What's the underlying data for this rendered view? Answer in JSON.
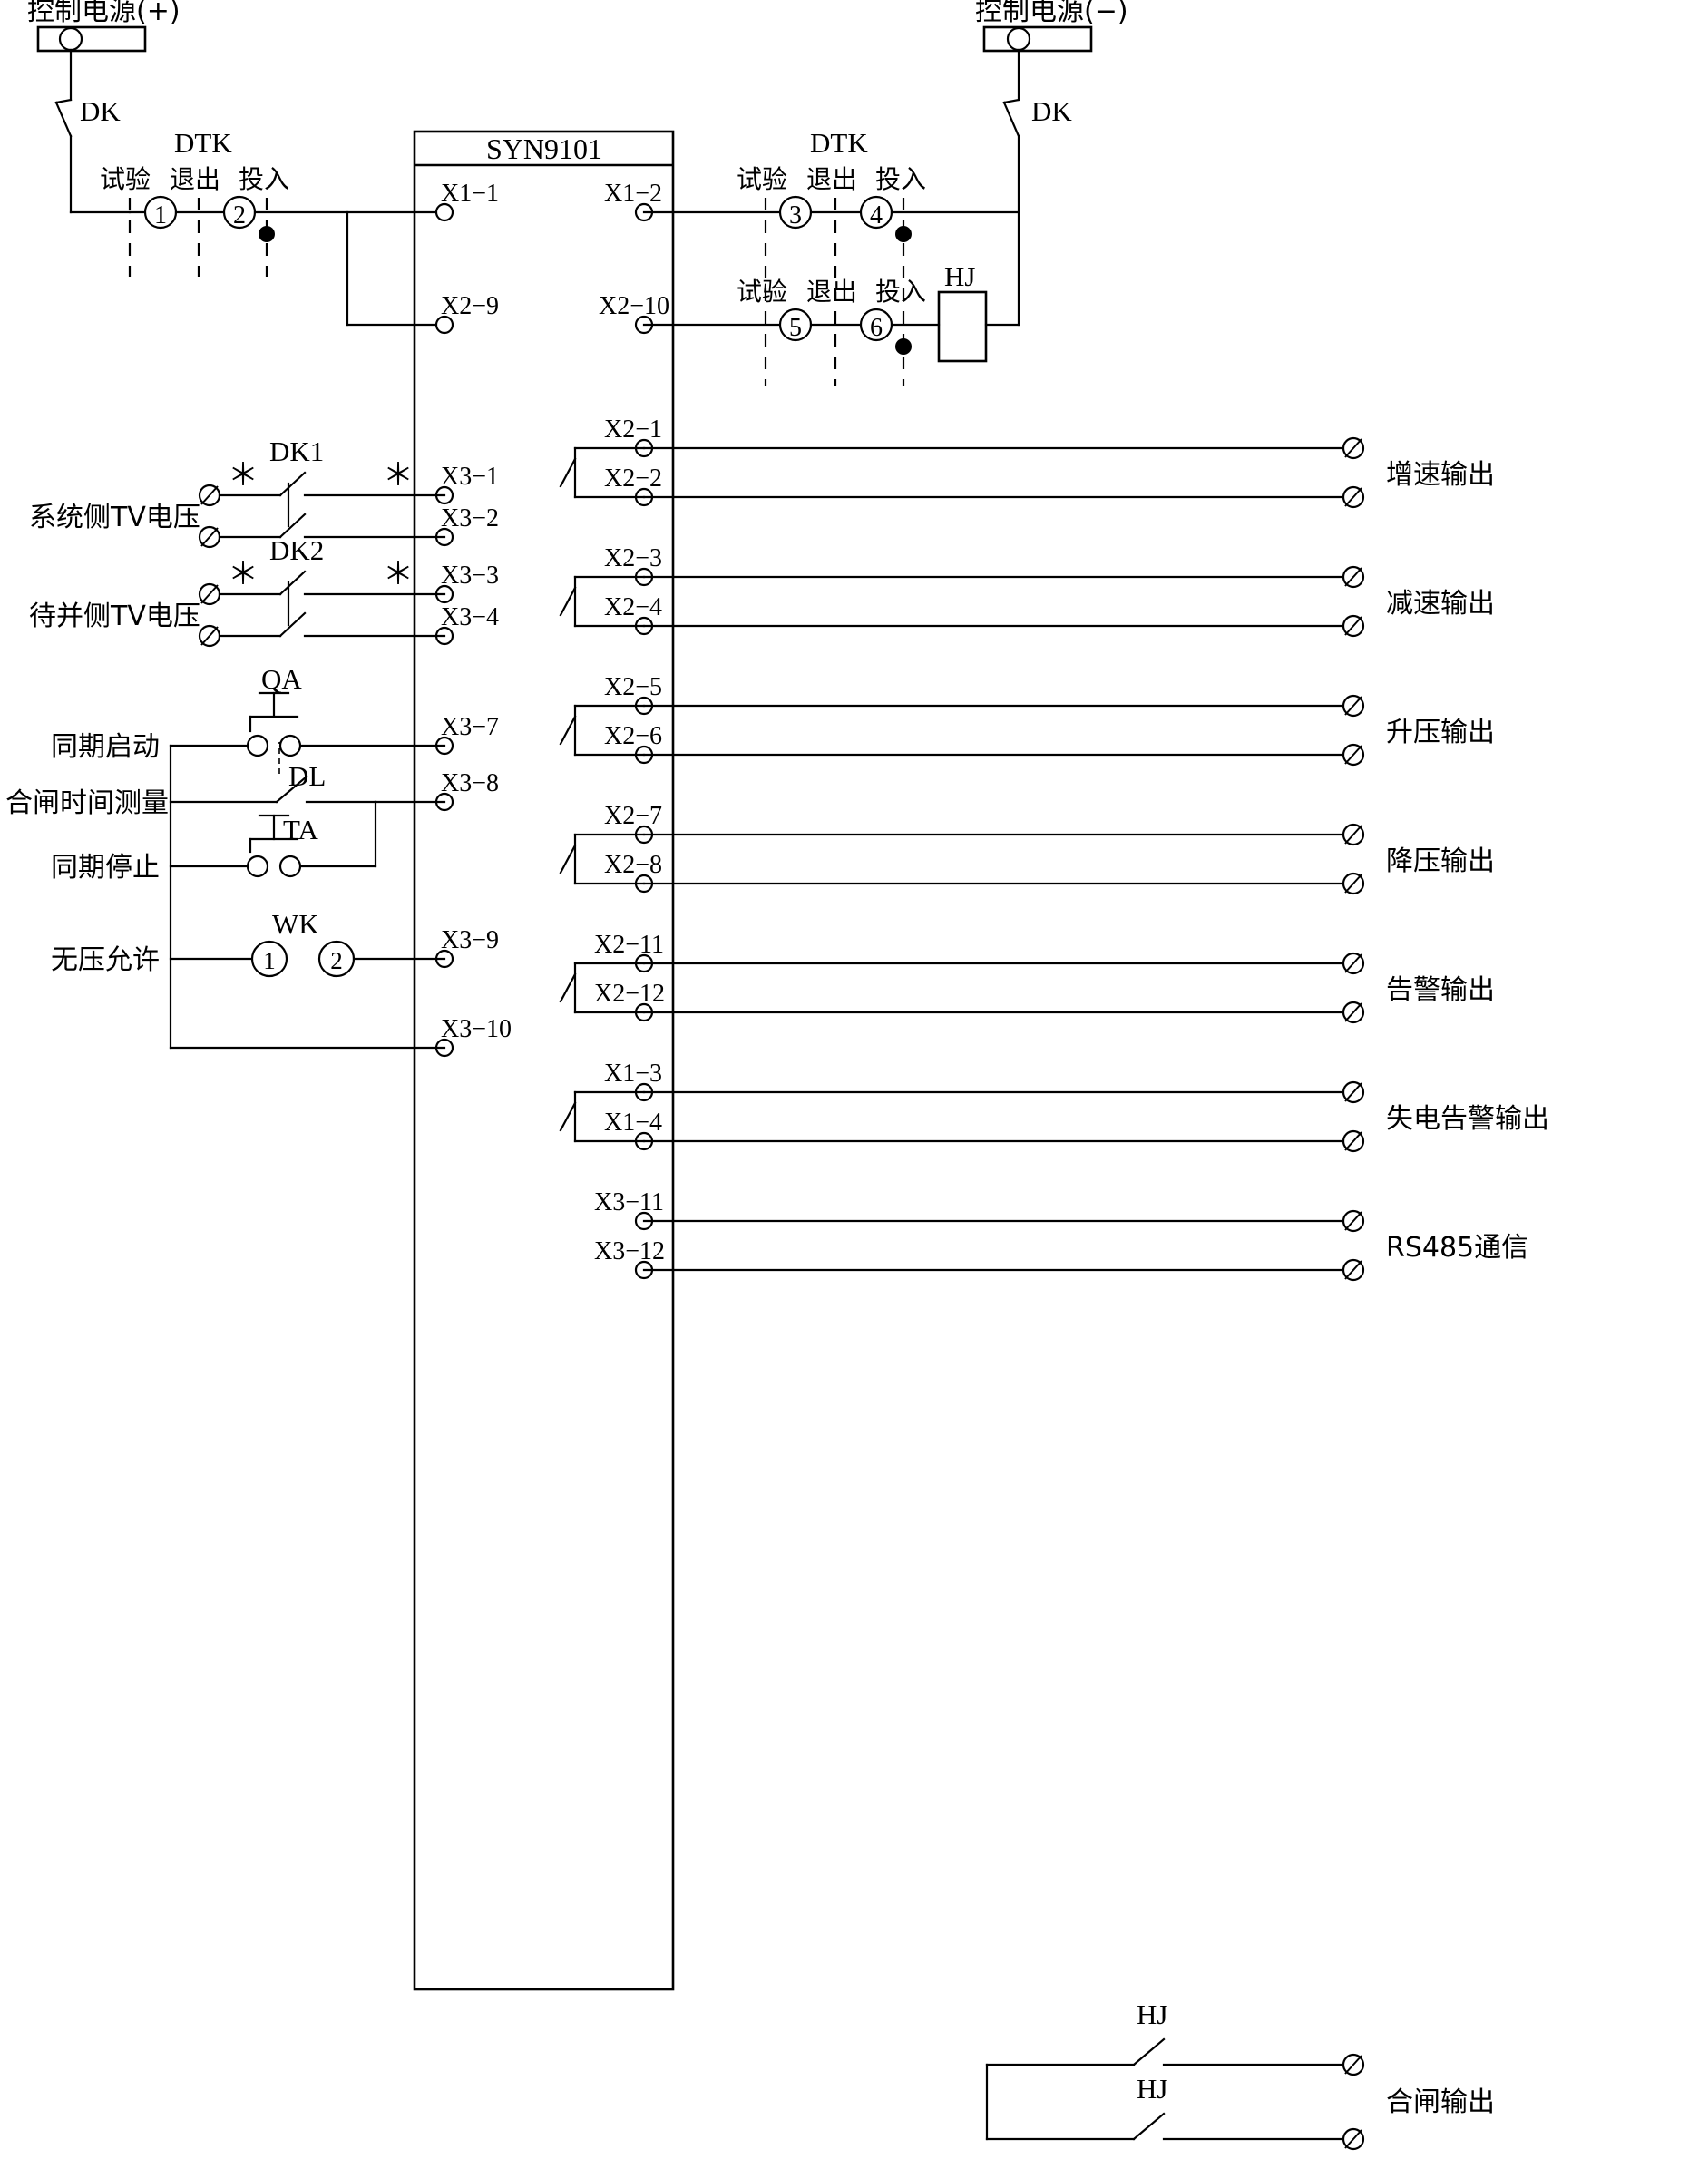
{
  "diagram": {
    "title": "SYN9101",
    "power_left_label": "控制电源(+)",
    "power_right_label": "控制电源(−)",
    "breaker_left_label": "DK",
    "breaker_right_label": "DK",
    "dtk_left_label": "DTK",
    "dtk_right_label": "DTK",
    "dtk_positions": {
      "test": "试验",
      "exit": "退出",
      "in": "投入"
    },
    "hj_coil_label": "HJ",
    "switch_numbers": {
      "n1": "1",
      "n2": "2",
      "n3": "3",
      "n4": "4",
      "n5": "5",
      "n6": "6"
    },
    "terminals": {
      "x1_1": "X1−1",
      "x1_2": "X1−2",
      "x2_9": "X2−9",
      "x2_10": "X2−10",
      "x3_1": "X3−1",
      "x3_2": "X3−2",
      "x3_3": "X3−3",
      "x3_4": "X3−4",
      "x3_7": "X3−7",
      "x3_8": "X3−8",
      "x3_9": "X3−9",
      "x3_10": "X3−10",
      "x2_1": "X2−1",
      "x2_2": "X2−2",
      "x2_3": "X2−3",
      "x2_4": "X2−4",
      "x2_5": "X2−5",
      "x2_6": "X2−6",
      "x2_7": "X2−7",
      "x2_8": "X2−8",
      "x2_11": "X2−11",
      "x2_12": "X2−12",
      "x1_3": "X1−3",
      "x1_4": "X1−4",
      "x3_11": "X3−11",
      "x3_12": "X3−12"
    },
    "inputs": {
      "tv_system_label": "系统侧TV电压",
      "tv_system_switch": "DK1",
      "tv_incoming_label": "待并侧TV电压",
      "tv_incoming_switch": "DK2",
      "polarity_mark": "＊",
      "sync_start_label": "同期启动",
      "sync_start_switch": "QA",
      "close_time_label": "合闸时间测量",
      "close_time_switch": "DL",
      "sync_stop_label": "同期停止",
      "sync_stop_switch": "TA",
      "no_voltage_label": "无压允许",
      "no_voltage_switch": "WK",
      "wk_terminal_1": "1",
      "wk_terminal_2": "2"
    },
    "outputs": [
      {
        "label": "增速输出",
        "top": "X2−1",
        "bottom": "X2−2"
      },
      {
        "label": "减速输出",
        "top": "X2−3",
        "bottom": "X2−4"
      },
      {
        "label": "升压输出",
        "top": "X2−5",
        "bottom": "X2−6"
      },
      {
        "label": "降压输出",
        "top": "X2−7",
        "bottom": "X2−8"
      },
      {
        "label": "告警输出",
        "top": "X2−11",
        "bottom": "X2−12"
      },
      {
        "label": "失电告警输出",
        "top": "X1−3",
        "bottom": "X1−4"
      },
      {
        "label": "RS485通信",
        "top": "X3−11",
        "bottom": "X3−12"
      }
    ],
    "close_output": {
      "label": "合闸输出",
      "contact_top_label": "HJ",
      "contact_bottom_label": "HJ"
    },
    "colors": {
      "line": "#000000",
      "background": "#ffffff"
    }
  }
}
